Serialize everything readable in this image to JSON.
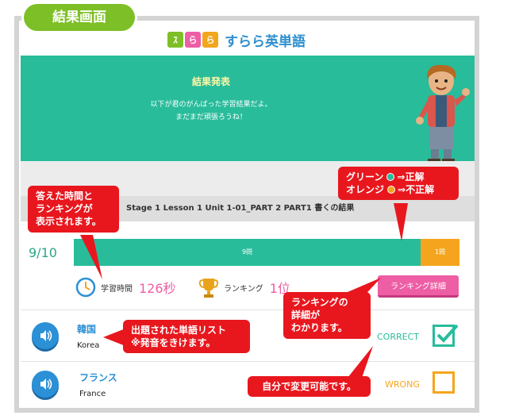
{
  "tag_label": "結果画面",
  "logo": {
    "tiles": [
      "ｽ",
      "ら",
      "ら"
    ],
    "text": "すらら英単語"
  },
  "banner": {
    "title": "結果発表",
    "message_line1": "以下が君のがんばった学習結果だよ。",
    "message_line2": "まだまだ頑張ろうね！"
  },
  "stage_title": "Stage 1 Lesson 1 Unit 1-01_PART 2 PART1 書くの結果",
  "score": "9/10",
  "progress": {
    "correct_label": "9問",
    "wrong_label": "1問",
    "correct_fraction": 0.9
  },
  "stats": {
    "time_label": "学習時間",
    "time_value": "126秒",
    "rank_label": "ランキング",
    "rank_value": "1位"
  },
  "ranking_button": "ランキング詳細",
  "words": [
    {
      "jp": "韓国",
      "en": "Korea",
      "result": "CORRECT",
      "status": "correct"
    },
    {
      "jp": "フランス",
      "en": "France",
      "result": "WRONG",
      "status": "wrong"
    }
  ],
  "callouts": {
    "time_rank": [
      "答えた時間と",
      "ランキングが",
      "表示されます。"
    ],
    "legend_green": "グリーン",
    "legend_green_meaning": "⇒正解",
    "legend_orange": "オレンジ",
    "legend_orange_meaning": "⇒不正解",
    "ranking_detail": [
      "ランキングの",
      "詳細が",
      "わかります。"
    ],
    "word_list": [
      "出題された単語リスト",
      "※発音をきけます。"
    ],
    "editable": "自分で変更可能です。"
  },
  "colors": {
    "accent_green": "#28bc9b",
    "accent_orange": "#f5a51d",
    "pink": "#ee5ea5",
    "callout_red": "#e8171e",
    "tag_green": "#7dbf26"
  }
}
